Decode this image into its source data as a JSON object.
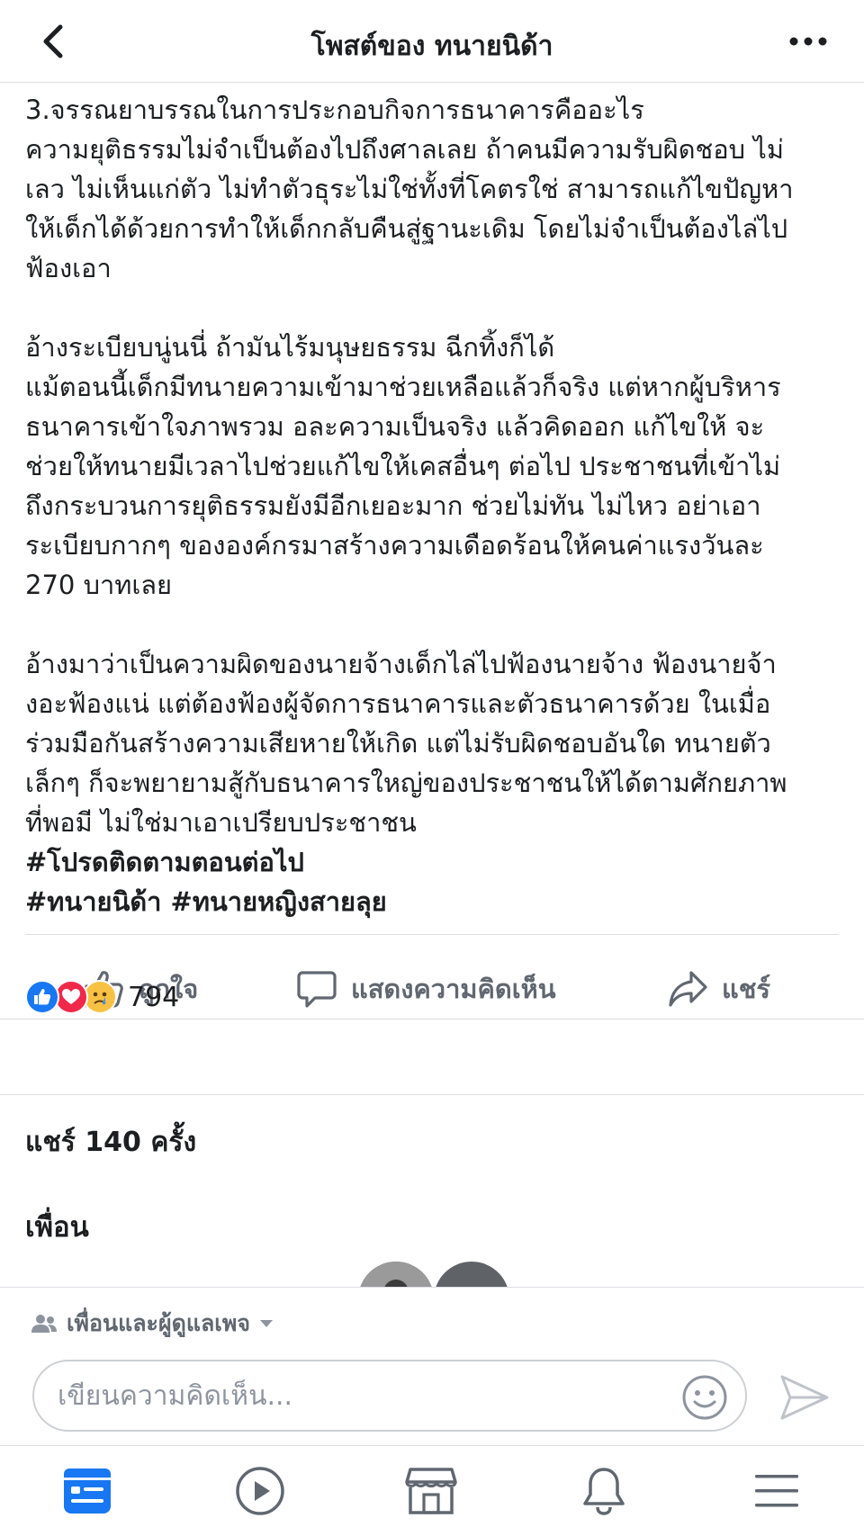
{
  "header": {
    "title": "โพสต์ของ ทนายนิด้า"
  },
  "post": {
    "paragraphs": [
      "3.จรรณยาบรรณในการประกอบกิจการธนาคารคืออะไร\nความยุติธรรมไม่จำเป็นต้องไปถึงศาลเลย ถ้าคนมีความรับผิดชอบ ไม่\nเลว ไม่เห็นแก่ตัว ไม่ทำตัวธุระไม่ใช่ทั้งที่โคตรใช่ สามารถแก้ไขปัญหา\nให้เด็กได้ด้วยการทำให้เด็กกลับคืนสู่ฐานะเดิม โดยไม่จำเป็นต้องไล่ไป\nฟ้องเอา",
      "อ้างระเบียบนู่นนี่ ถ้ามันไร้มนุษยธรรม ฉีกทิ้งก็ได้\nแม้ตอนนี้เด็กมีทนายความเข้ามาช่วยเหลือแล้วก็จริง แต่หากผู้บริหาร\nธนาคารเข้าใจภาพรวม อละความเป็นจริง แล้วคิดออก แก้ไขให้ จะ\nช่วยให้ทนายมีเวลาไปช่วยแก้ไขให้เคสอื่นๆ ต่อไป ประชาชนที่เข้าไม่\nถึงกระบวนการยุติธรรมยังมีอีกเยอะมาก ช่วยไม่ทัน ไม่ไหว อย่าเอา\nระเบียบกากๆ ขององค์กรมาสร้างความเดือดร้อนให้คนค่าแรงวันละ\n270 บาทเลย",
      "อ้างมาว่าเป็นความผิดของนายจ้างเด็กไล่ไปฟ้องนายจ้าง ฟ้องนายจ้า\nงอะฟ้องแน่ แต่ต้องฟ้องผู้จัดการธนาคารและตัวธนาคารด้วย ในเมื่อ\nร่วมมือกันสร้างความเสียหายให้เกิด แต่ไม่รับผิดชอบอันใด ทนายตัว\nเล็กๆ ก็จะพยายามสู้กับธนาคารใหญ่ของประชาชนให้ได้ตามศักยภาพ\nที่พอมี ไม่ใช่มาเอาเปรียบประชาชน"
    ],
    "hashtags": [
      "#โปรดติดตามตอนต่อไป",
      "#ทนายนิด้า #ทนายหญิงสายลุย"
    ]
  },
  "actions": {
    "like_label": "ถูกใจ",
    "comment_label": "แสดงความคิดเห็น",
    "share_label": "แชร์"
  },
  "reactions": {
    "count": "794",
    "types": [
      "like",
      "love",
      "sad"
    ]
  },
  "shares": {
    "label": "แชร์ 140 ครั้ง"
  },
  "friends": {
    "title": "เพื่อน"
  },
  "composer": {
    "audience_label": "เพื่อนและผู้ดูแลเพจ",
    "placeholder": "เขียนความคิดเห็น..."
  },
  "tabbar": {
    "items": [
      "news-feed-icon",
      "watch-icon",
      "marketplace-icon",
      "notifications-icon",
      "menu-icon"
    ],
    "active": "news-feed-icon"
  },
  "colors": {
    "accent": "#1877f2",
    "love": "#f0284a",
    "sad": "#f7c244",
    "secondary_text": "#606770",
    "divider": "#dcdee3"
  }
}
